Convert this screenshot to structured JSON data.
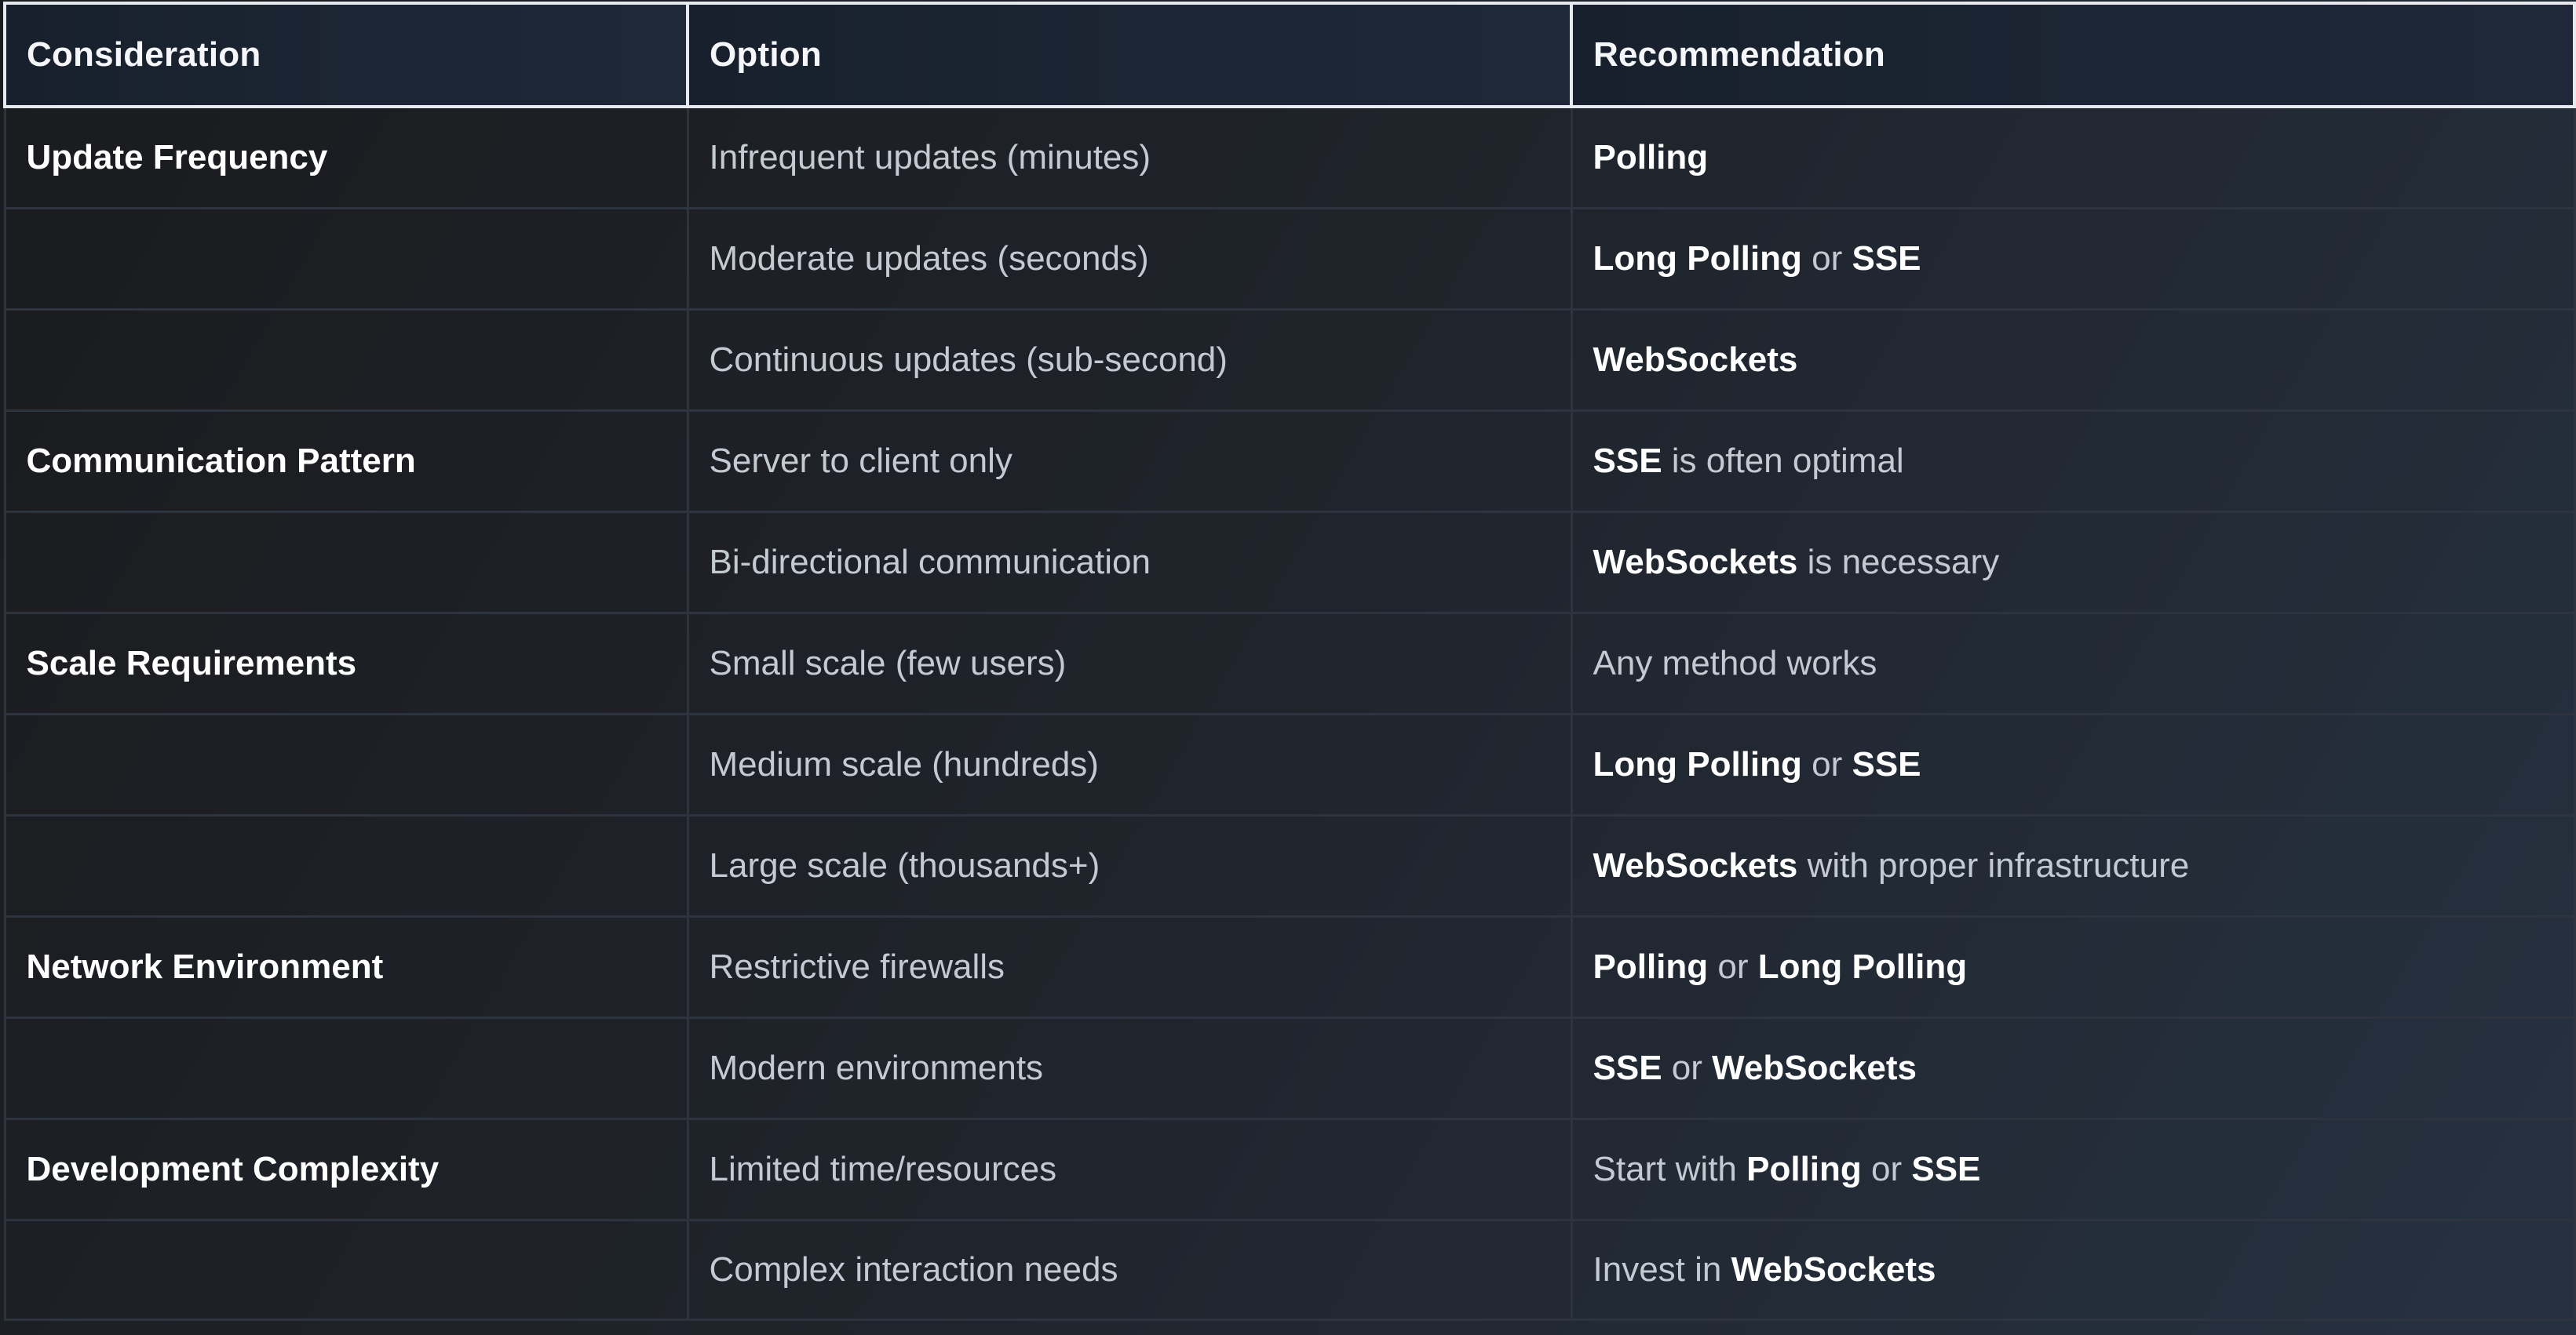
{
  "table": {
    "headers": {
      "consideration": "Consideration",
      "option": "Option",
      "recommendation": "Recommendation"
    },
    "rows": [
      {
        "consideration": "Update Frequency",
        "option": "Infrequent updates (minutes)",
        "recommendation": [
          {
            "text": "Polling",
            "bold": true
          }
        ]
      },
      {
        "consideration": "",
        "option": "Moderate updates (seconds)",
        "recommendation": [
          {
            "text": "Long Polling",
            "bold": true
          },
          {
            "text": " or ",
            "bold": false
          },
          {
            "text": "SSE",
            "bold": true
          }
        ]
      },
      {
        "consideration": "",
        "option": "Continuous updates (sub-second)",
        "recommendation": [
          {
            "text": "WebSockets",
            "bold": true
          }
        ]
      },
      {
        "consideration": "Communication Pattern",
        "option": "Server to client only",
        "recommendation": [
          {
            "text": "SSE",
            "bold": true
          },
          {
            "text": " is often optimal",
            "bold": false
          }
        ]
      },
      {
        "consideration": "",
        "option": "Bi-directional communication",
        "recommendation": [
          {
            "text": "WebSockets",
            "bold": true
          },
          {
            "text": " is necessary",
            "bold": false
          }
        ]
      },
      {
        "consideration": "Scale Requirements",
        "option": "Small scale (few users)",
        "recommendation": [
          {
            "text": "Any method works",
            "bold": false
          }
        ]
      },
      {
        "consideration": "",
        "option": "Medium scale (hundreds)",
        "recommendation": [
          {
            "text": "Long Polling",
            "bold": true
          },
          {
            "text": " or ",
            "bold": false
          },
          {
            "text": "SSE",
            "bold": true
          }
        ]
      },
      {
        "consideration": "",
        "option": "Large scale (thousands+)",
        "recommendation": [
          {
            "text": "WebSockets",
            "bold": true
          },
          {
            "text": " with proper infrastructure",
            "bold": false
          }
        ]
      },
      {
        "consideration": "Network Environment",
        "option": "Restrictive firewalls",
        "recommendation": [
          {
            "text": "Polling",
            "bold": true
          },
          {
            "text": " or ",
            "bold": false
          },
          {
            "text": "Long Polling",
            "bold": true
          }
        ]
      },
      {
        "consideration": "",
        "option": "Modern environments",
        "recommendation": [
          {
            "text": "SSE",
            "bold": true
          },
          {
            "text": " or ",
            "bold": false
          },
          {
            "text": "WebSockets",
            "bold": true
          }
        ]
      },
      {
        "consideration": "Development Complexity",
        "option": "Limited time/resources",
        "recommendation": [
          {
            "text": "Start with ",
            "bold": false
          },
          {
            "text": "Polling",
            "bold": true
          },
          {
            "text": " or ",
            "bold": false
          },
          {
            "text": "SSE",
            "bold": true
          }
        ]
      },
      {
        "consideration": "",
        "option": "Complex interaction needs",
        "recommendation": [
          {
            "text": "Invest in ",
            "bold": false
          },
          {
            "text": "WebSockets",
            "bold": true
          }
        ]
      }
    ]
  },
  "colors": {
    "header_border": "#e6e9ee",
    "cell_border": "#2d3440",
    "bold_text": "#ffffff",
    "regular_text": "#c4cad2"
  }
}
